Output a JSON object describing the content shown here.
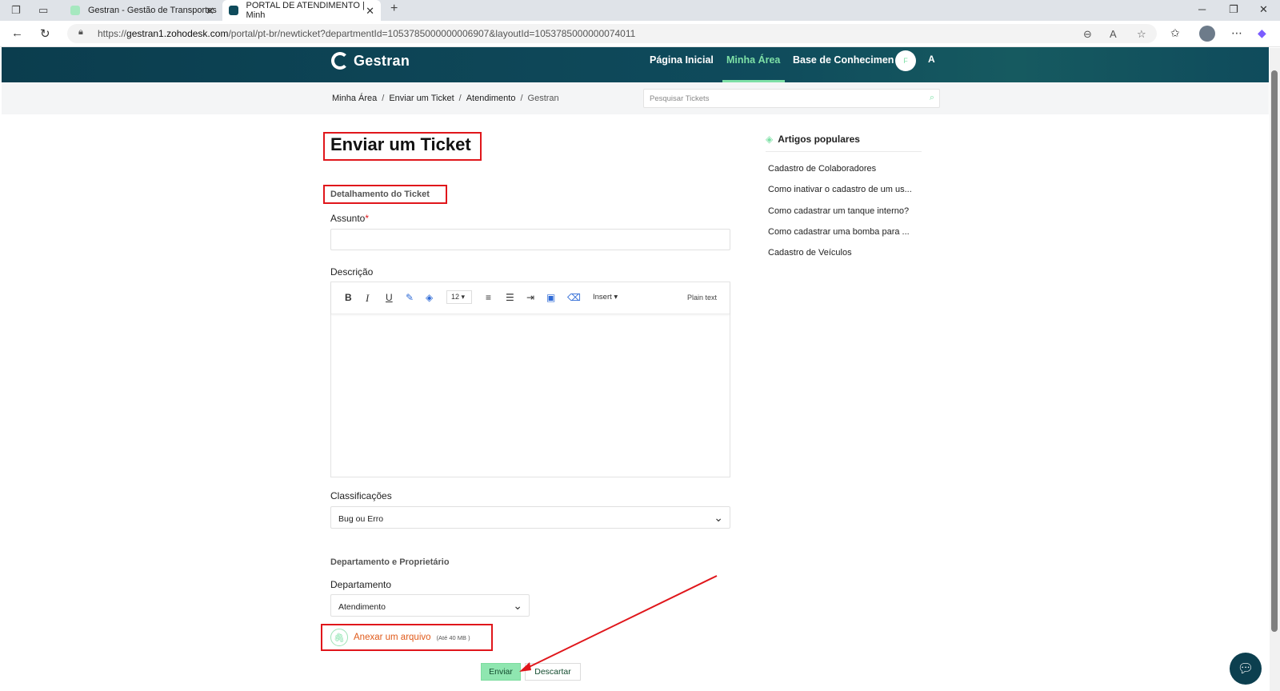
{
  "browser": {
    "tabs": [
      {
        "title": "Gestran - Gestão de Transportes"
      },
      {
        "title": "PORTAL DE ATENDIMENTO | Minh"
      }
    ],
    "new_tab": "+",
    "url_host": "gestran1.zohodesk.com",
    "url_prefix": "https://",
    "url_path": "/portal/pt-br/newticket?departmentId=1053785000000006907&layoutId=1053785000000074011"
  },
  "header": {
    "logo_text": "Gestran",
    "nav": [
      {
        "label": "Página Inicial"
      },
      {
        "label": "Minha Área"
      },
      {
        "label": "Base de Conhecimen"
      }
    ],
    "user_initials": "F",
    "font_toggle": "A"
  },
  "breadcrumb": {
    "items": [
      "Minha Área",
      "Enviar um Ticket",
      "Atendimento",
      "Gestran"
    ],
    "separator": "/"
  },
  "search": {
    "placeholder": "Pesquisar Tickets"
  },
  "form": {
    "title": "Enviar um Ticket",
    "section": "Detalhamento do Ticket",
    "subject_label": "Assunto",
    "required_mark": "*",
    "description_label": "Descrição",
    "toolbar": {
      "bold": "B",
      "italic": "I",
      "underline": "U",
      "font_size": "12",
      "insert": "Insert",
      "plain_text": "Plain text"
    },
    "classification_label": "Classificações",
    "classification_value": "Bug ou Erro",
    "dept_section": "Departamento e Proprietário",
    "dept_label": "Departamento",
    "dept_value": "Atendimento",
    "attach_label": "Anexar um arquivo",
    "attach_limit": "(Até 40 MB )",
    "send": "Enviar",
    "discard": "Descartar"
  },
  "sidebar": {
    "title": "Artigos populares",
    "articles": [
      "Cadastro de Colaboradores",
      "Como inativar o cadastro de um us...",
      "Como cadastrar um tanque interno?",
      "Como cadastrar uma bomba para ...",
      "Cadastro de Veículos"
    ]
  },
  "colors": {
    "header_bg": "#0b3d4e",
    "accent_green": "#7ee0a6",
    "annotation_red": "#e0161b",
    "attach_orange": "#e05a1a"
  }
}
